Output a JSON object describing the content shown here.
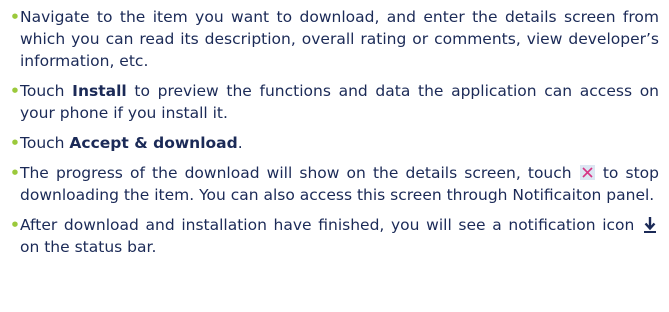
{
  "bullet_char": "•",
  "colors": {
    "text": "#1b2a57",
    "bullet": "#9bc93b",
    "stop_icon_bg": "#dce6f2",
    "stop_icon_x": "#d63384"
  },
  "items": [
    {
      "text": "Navigate to the item you want to download, and enter the details screen from which you can read its description, overall rating or comments, view developer’s information, etc."
    },
    {
      "pre": "Touch ",
      "bold": "Install",
      "post": " to preview the functions and data the application can access on your phone if you install it."
    },
    {
      "pre": "Touch ",
      "bold": "Accept & download",
      "post": "."
    },
    {
      "pre": "The progress of the download will show on the details screen, touch ",
      "icon": "stop-download-icon",
      "post": " to stop downloading the item. You can also access this screen through Notificaiton panel."
    },
    {
      "pre": "After download and installation have finished, you will see a notification icon ",
      "icon": "download-notification-icon",
      "post": " on the status bar."
    }
  ]
}
